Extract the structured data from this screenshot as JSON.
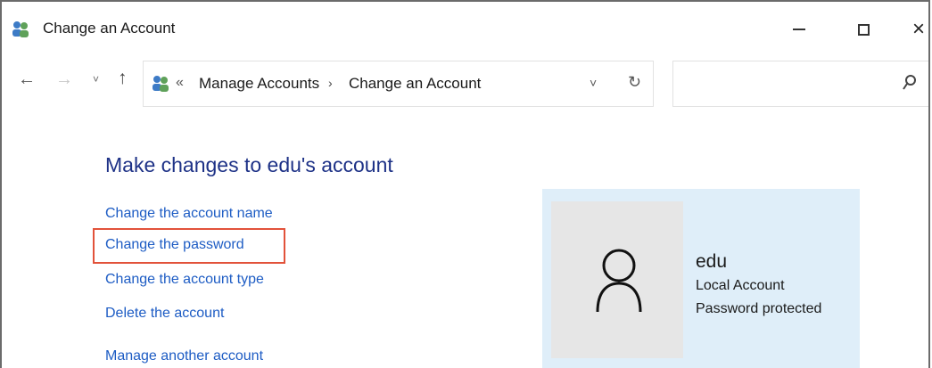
{
  "window": {
    "title": "Change an Account",
    "controls": {
      "minimize": "minimize",
      "maximize": "maximize",
      "close": "×"
    }
  },
  "nav": {
    "back": "←",
    "forward": "→",
    "recent": "˅",
    "up": "↑",
    "breadcrumb_more": "«",
    "breadcrumbs": [
      "Manage Accounts",
      "Change an Account"
    ],
    "separator": "›",
    "dropdown": "˅",
    "refresh": "↻",
    "search_placeholder": ""
  },
  "main": {
    "heading": "Make changes to edu's account",
    "links": [
      "Change the account name",
      "Change the password",
      "Change the account type",
      "Delete the account",
      "Manage another account"
    ],
    "highlighted_link_index": 1,
    "highlight_color": "#e2523a"
  },
  "account": {
    "name": "edu",
    "type": "Local Account",
    "status": "Password protected",
    "panel_color": "#dfeef9",
    "avatar_icon": "user-silhouette-icon"
  },
  "colors": {
    "link": "#1d5cc4",
    "heading": "#1e3287"
  }
}
